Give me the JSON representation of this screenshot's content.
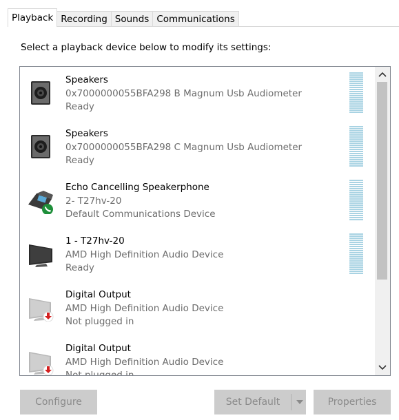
{
  "tabs": [
    {
      "label": "Playback",
      "active": true
    },
    {
      "label": "Recording"
    },
    {
      "label": "Sounds"
    },
    {
      "label": "Communications"
    }
  ],
  "instruction": "Select a playback device below to modify its settings:",
  "devices": [
    {
      "name": "Speakers",
      "line2": "0x7000000055BFA298 B Magnum Usb Audiometer",
      "status": "Ready",
      "icon": "speaker-icon"
    },
    {
      "name": "Speakers",
      "line2": "0x7000000055BFA298 C Magnum Usb Audiometer",
      "status": "Ready",
      "icon": "speaker-icon"
    },
    {
      "name": "Echo Cancelling Speakerphone",
      "line2": "2- T27hv-20",
      "status": "Default Communications Device",
      "icon": "speakerphone-icon"
    },
    {
      "name": "1 - T27hv-20",
      "line2": "AMD High Definition Audio Device",
      "status": "Ready",
      "icon": "monitor-icon"
    },
    {
      "name": "Digital Output",
      "line2": "AMD High Definition Audio Device",
      "status": "Not plugged in",
      "icon": "monitor-unplugged-icon"
    },
    {
      "name": "Digital Output",
      "line2": "AMD High Definition Audio Device",
      "status": "Not plugged in",
      "icon": "monitor-unplugged-icon"
    }
  ],
  "buttons": {
    "configure": "Configure",
    "set_default": "Set Default",
    "properties": "Properties"
  },
  "colors": {
    "meter": "#a9d3e3",
    "disabled_button": "#cccccc",
    "secondary_text": "#6d6d6d"
  }
}
